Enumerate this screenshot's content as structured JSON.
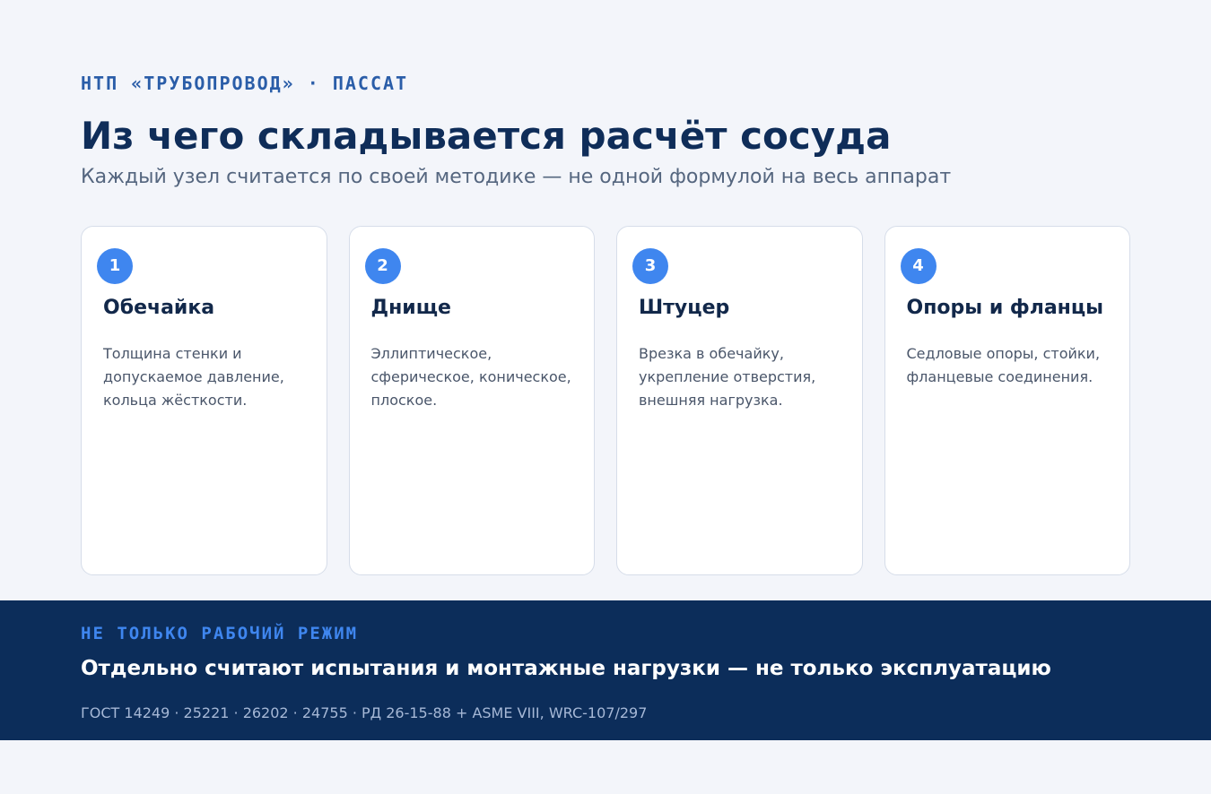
{
  "header": {
    "eyebrow": "НТП «ТРУБОПРОВОД» · ПАССАТ",
    "title": "Из чего складывается расчёт сосуда",
    "subtitle": "Каждый узел считается по своей методике — не одной формулой на весь аппарат"
  },
  "cards": [
    {
      "number": "1",
      "title": "Обечайка",
      "description": "Толщина стенки и допускаемое давление, кольца жёсткости."
    },
    {
      "number": "2",
      "title": "Днище",
      "description": "Эллиптическое, сферическое, коническое, плоское."
    },
    {
      "number": "3",
      "title": "Штуцер",
      "description": "Врезка в обечайку, укрепление отверстия, внешняя нагрузка."
    },
    {
      "number": "4",
      "title": "Опоры и фланцы",
      "description": "Седловые опоры, стойки, фланцевые соединения."
    }
  ],
  "footer": {
    "eyebrow": "НЕ ТОЛЬКО РАБОЧИЙ РЕЖИМ",
    "title": "Отдельно считают испытания и монтажные нагрузки — не только эксплуатацию",
    "refs": "ГОСТ 14249 · 25221 · 26202 · 24755 · РД 26-15-88 + ASME VIII, WRC-107/297"
  },
  "colors": {
    "background": "#f3f5fa",
    "accent": "#3f86ef",
    "navy": "#0c2d5a",
    "title": "#0f2d59"
  }
}
